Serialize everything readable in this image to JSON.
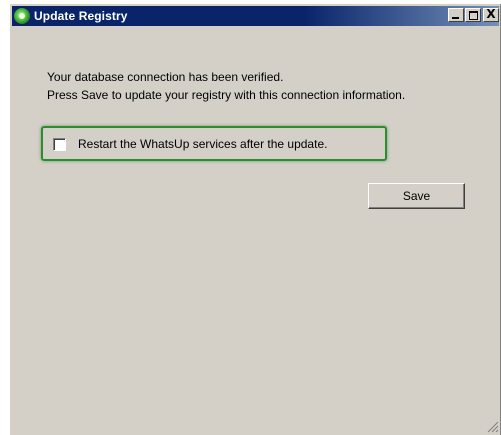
{
  "window": {
    "title": "Update Registry",
    "app_icon": "whatsup-green-globe-icon",
    "controls": {
      "minimize_icon": "minimize-icon",
      "maximize_icon": "maximize-icon",
      "close_icon": "close-icon",
      "close_glyph": "X"
    }
  },
  "message": {
    "line1": "Your database connection has been verified.",
    "line2": "Press Save to update your registry with this connection information."
  },
  "restart_option": {
    "label": "Restart the WhatsUp services after the update.",
    "checked": false,
    "highlight_color": "#2e8b2e"
  },
  "save_button": {
    "label": "Save"
  },
  "colors": {
    "titlebar": "#0a246a",
    "dialog_background": "#d4d0c8"
  }
}
